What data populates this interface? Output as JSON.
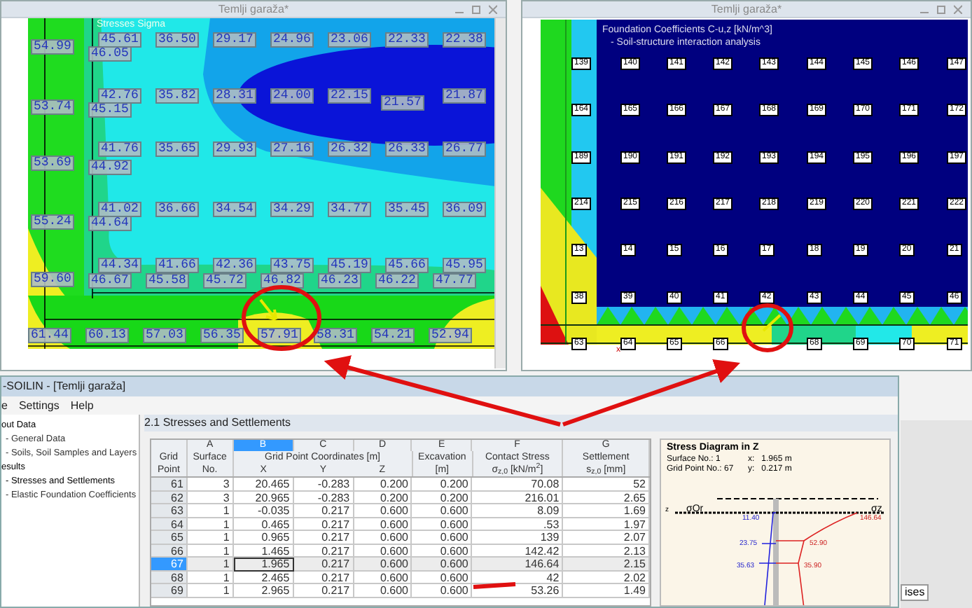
{
  "stress_window": {
    "title": "Temlji garaža*",
    "plot_title": "Stresses Sigma",
    "rows": [
      [
        "54.99",
        "46.05",
        "45.61",
        "36.50",
        "29.17",
        "24.96",
        "23.06",
        "22.33",
        "22.38"
      ],
      [
        "53.74",
        "45.15",
        "42.76",
        "35.82",
        "28.31",
        "24.00",
        "22.15",
        "21.57",
        "21.87"
      ],
      [
        "53.69",
        "44.92",
        "41.76",
        "35.65",
        "29.93",
        "27.16",
        "26.32",
        "26.33",
        "26.77"
      ],
      [
        "55.24",
        "44.64",
        "41.02",
        "36.66",
        "34.54",
        "34.29",
        "34.77",
        "35.45",
        "36.09"
      ],
      [
        "",
        "44.34",
        "41.66",
        "42.36",
        "43.75",
        "45.19",
        "45.66",
        "45.95"
      ],
      [
        "59.60",
        "46.67",
        "45.58",
        "45.72",
        "46.82",
        "46.23",
        "46.22",
        "47.77"
      ],
      [
        "61.44",
        "60.13",
        "57.03",
        "56.35",
        "57.91",
        "58.31",
        "54.21",
        "52.94"
      ]
    ]
  },
  "coefficient_window": {
    "title": "Temlji garaža*",
    "plot_title": "Foundation Coefficients C-u,z [kN/m^3]",
    "plot_subtitle": "- Soil-structure interaction analysis",
    "rows": [
      [
        "139",
        "140",
        "141",
        "142",
        "143",
        "144",
        "145",
        "146",
        "147"
      ],
      [
        "164",
        "165",
        "166",
        "167",
        "168",
        "169",
        "170",
        "171",
        "172"
      ],
      [
        "189",
        "190",
        "191",
        "192",
        "193",
        "194",
        "195",
        "196",
        "197"
      ],
      [
        "214",
        "215",
        "216",
        "217",
        "218",
        "219",
        "220",
        "221",
        "222"
      ],
      [
        "13",
        "14",
        "15",
        "16",
        "17",
        "18",
        "19",
        "20",
        "21"
      ],
      [
        "38",
        "39",
        "40",
        "41",
        "42",
        "43",
        "44",
        "45",
        "46"
      ],
      [
        "63",
        "64",
        "65",
        "66",
        "",
        "68",
        "69",
        "70",
        "71"
      ]
    ],
    "axis_label": "x"
  },
  "main_window": {
    "title": "-SOILIN - [Temlji garaža]",
    "menu": [
      "e",
      "Settings",
      "Help"
    ],
    "tree": [
      {
        "label": "out Data",
        "children": [
          {
            "label": "- General Data",
            "selected": false
          },
          {
            "label": "- Soils, Soil Samples and Layers",
            "selected": false
          }
        ]
      },
      {
        "label": "esults",
        "children": [
          {
            "label": "- Stresses and Settlements",
            "selected": true
          },
          {
            "label": "- Elastic Foundation Coefficients",
            "selected": false
          }
        ]
      }
    ],
    "panel_title": "2.1 Stresses and Settlements",
    "table": {
      "letters": [
        {
          "text": "A",
          "selected": false
        },
        {
          "text": "B",
          "selected": true
        },
        {
          "text": "C",
          "selected": false
        },
        {
          "text": "D",
          "selected": false
        },
        {
          "text": "E",
          "selected": false
        },
        {
          "text": "F",
          "selected": false
        },
        {
          "text": "G",
          "selected": false
        }
      ],
      "headers": [
        "Grid Point",
        "Surface No.",
        "Grid Point Coordinates [m]",
        "Excavation",
        "Contact Stress",
        "Settlement"
      ],
      "subheaders": [
        "X",
        "Y",
        "Z",
        "[m]",
        "σ$_{z,0}$ [kN/m$^{2}$]",
        "s$_{z,0}$ [mm]"
      ],
      "rows": [
        {
          "cells": [
            "61",
            "3",
            "20.465",
            "-0.283",
            "0.200",
            "0.200",
            "70.08",
            "52"
          ],
          "selected": false,
          "cursor": false
        },
        {
          "cells": [
            "62",
            "3",
            "20.965",
            "-0.283",
            "0.200",
            "0.200",
            "216.01",
            "2.65"
          ],
          "selected": false,
          "cursor": false
        },
        {
          "cells": [
            "63",
            "1",
            "-0.035",
            "0.217",
            "0.600",
            "0.600",
            "8.09",
            "1.69"
          ],
          "selected": false,
          "cursor": false
        },
        {
          "cells": [
            "64",
            "1",
            "0.465",
            "0.217",
            "0.600",
            "0.600",
            ".53",
            "1.97"
          ],
          "selected": false,
          "cursor": false
        },
        {
          "cells": [
            "65",
            "1",
            "0.965",
            "0.217",
            "0.600",
            "0.600",
            "139",
            "2.07"
          ],
          "selected": false,
          "cursor": false
        },
        {
          "cells": [
            "66",
            "1",
            "1.465",
            "0.217",
            "0.600",
            "0.600",
            "142.42",
            "2.13"
          ],
          "selected": false,
          "cursor": false
        },
        {
          "cells": [
            "67",
            "1",
            "1.965",
            "0.217",
            "0.600",
            "0.600",
            "146.64",
            "2.15"
          ],
          "selected": true,
          "cursor": true
        },
        {
          "cells": [
            "68",
            "1",
            "2.465",
            "0.217",
            "0.600",
            "0.600",
            "42",
            "2.02"
          ],
          "selected": false,
          "cursor": false
        },
        {
          "cells": [
            "69",
            "1",
            "2.965",
            "0.217",
            "0.600",
            "0.600",
            "53.26",
            "1.49"
          ],
          "selected": false,
          "cursor": false
        }
      ]
    },
    "diagram": {
      "title": "Stress Diagram in Z",
      "surface": "Surface No.: 1",
      "x": "x:   1.965 m",
      "grid_point": "Grid Point No.: 67",
      "y": "y:   0.217 m",
      "axis_left": "σOr",
      "axis_right": "σz",
      "z_label": "z",
      "blue_values": [
        "11.40",
        "23.75",
        "35.63"
      ],
      "red_values": [
        "146.64",
        "52.90",
        "35.90"
      ]
    },
    "side_tab": "ises"
  }
}
